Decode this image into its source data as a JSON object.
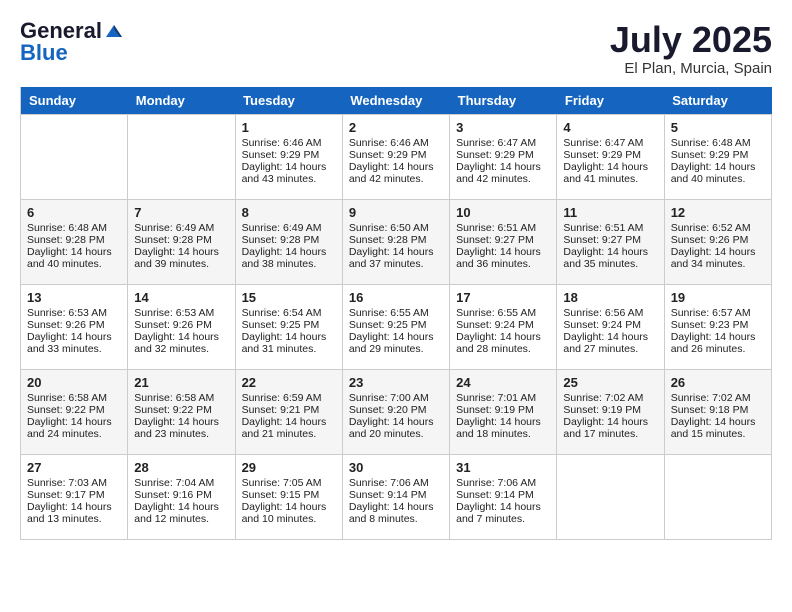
{
  "header": {
    "logo_general": "General",
    "logo_blue": "Blue",
    "month": "July 2025",
    "location": "El Plan, Murcia, Spain"
  },
  "days_of_week": [
    "Sunday",
    "Monday",
    "Tuesday",
    "Wednesday",
    "Thursday",
    "Friday",
    "Saturday"
  ],
  "weeks": [
    [
      {
        "day": "",
        "empty": true
      },
      {
        "day": "",
        "empty": true
      },
      {
        "day": "1",
        "sunrise": "Sunrise: 6:46 AM",
        "sunset": "Sunset: 9:29 PM",
        "daylight": "Daylight: 14 hours and 43 minutes."
      },
      {
        "day": "2",
        "sunrise": "Sunrise: 6:46 AM",
        "sunset": "Sunset: 9:29 PM",
        "daylight": "Daylight: 14 hours and 42 minutes."
      },
      {
        "day": "3",
        "sunrise": "Sunrise: 6:47 AM",
        "sunset": "Sunset: 9:29 PM",
        "daylight": "Daylight: 14 hours and 42 minutes."
      },
      {
        "day": "4",
        "sunrise": "Sunrise: 6:47 AM",
        "sunset": "Sunset: 9:29 PM",
        "daylight": "Daylight: 14 hours and 41 minutes."
      },
      {
        "day": "5",
        "sunrise": "Sunrise: 6:48 AM",
        "sunset": "Sunset: 9:29 PM",
        "daylight": "Daylight: 14 hours and 40 minutes."
      }
    ],
    [
      {
        "day": "6",
        "sunrise": "Sunrise: 6:48 AM",
        "sunset": "Sunset: 9:28 PM",
        "daylight": "Daylight: 14 hours and 40 minutes."
      },
      {
        "day": "7",
        "sunrise": "Sunrise: 6:49 AM",
        "sunset": "Sunset: 9:28 PM",
        "daylight": "Daylight: 14 hours and 39 minutes."
      },
      {
        "day": "8",
        "sunrise": "Sunrise: 6:49 AM",
        "sunset": "Sunset: 9:28 PM",
        "daylight": "Daylight: 14 hours and 38 minutes."
      },
      {
        "day": "9",
        "sunrise": "Sunrise: 6:50 AM",
        "sunset": "Sunset: 9:28 PM",
        "daylight": "Daylight: 14 hours and 37 minutes."
      },
      {
        "day": "10",
        "sunrise": "Sunrise: 6:51 AM",
        "sunset": "Sunset: 9:27 PM",
        "daylight": "Daylight: 14 hours and 36 minutes."
      },
      {
        "day": "11",
        "sunrise": "Sunrise: 6:51 AM",
        "sunset": "Sunset: 9:27 PM",
        "daylight": "Daylight: 14 hours and 35 minutes."
      },
      {
        "day": "12",
        "sunrise": "Sunrise: 6:52 AM",
        "sunset": "Sunset: 9:26 PM",
        "daylight": "Daylight: 14 hours and 34 minutes."
      }
    ],
    [
      {
        "day": "13",
        "sunrise": "Sunrise: 6:53 AM",
        "sunset": "Sunset: 9:26 PM",
        "daylight": "Daylight: 14 hours and 33 minutes."
      },
      {
        "day": "14",
        "sunrise": "Sunrise: 6:53 AM",
        "sunset": "Sunset: 9:26 PM",
        "daylight": "Daylight: 14 hours and 32 minutes."
      },
      {
        "day": "15",
        "sunrise": "Sunrise: 6:54 AM",
        "sunset": "Sunset: 9:25 PM",
        "daylight": "Daylight: 14 hours and 31 minutes."
      },
      {
        "day": "16",
        "sunrise": "Sunrise: 6:55 AM",
        "sunset": "Sunset: 9:25 PM",
        "daylight": "Daylight: 14 hours and 29 minutes."
      },
      {
        "day": "17",
        "sunrise": "Sunrise: 6:55 AM",
        "sunset": "Sunset: 9:24 PM",
        "daylight": "Daylight: 14 hours and 28 minutes."
      },
      {
        "day": "18",
        "sunrise": "Sunrise: 6:56 AM",
        "sunset": "Sunset: 9:24 PM",
        "daylight": "Daylight: 14 hours and 27 minutes."
      },
      {
        "day": "19",
        "sunrise": "Sunrise: 6:57 AM",
        "sunset": "Sunset: 9:23 PM",
        "daylight": "Daylight: 14 hours and 26 minutes."
      }
    ],
    [
      {
        "day": "20",
        "sunrise": "Sunrise: 6:58 AM",
        "sunset": "Sunset: 9:22 PM",
        "daylight": "Daylight: 14 hours and 24 minutes."
      },
      {
        "day": "21",
        "sunrise": "Sunrise: 6:58 AM",
        "sunset": "Sunset: 9:22 PM",
        "daylight": "Daylight: 14 hours and 23 minutes."
      },
      {
        "day": "22",
        "sunrise": "Sunrise: 6:59 AM",
        "sunset": "Sunset: 9:21 PM",
        "daylight": "Daylight: 14 hours and 21 minutes."
      },
      {
        "day": "23",
        "sunrise": "Sunrise: 7:00 AM",
        "sunset": "Sunset: 9:20 PM",
        "daylight": "Daylight: 14 hours and 20 minutes."
      },
      {
        "day": "24",
        "sunrise": "Sunrise: 7:01 AM",
        "sunset": "Sunset: 9:19 PM",
        "daylight": "Daylight: 14 hours and 18 minutes."
      },
      {
        "day": "25",
        "sunrise": "Sunrise: 7:02 AM",
        "sunset": "Sunset: 9:19 PM",
        "daylight": "Daylight: 14 hours and 17 minutes."
      },
      {
        "day": "26",
        "sunrise": "Sunrise: 7:02 AM",
        "sunset": "Sunset: 9:18 PM",
        "daylight": "Daylight: 14 hours and 15 minutes."
      }
    ],
    [
      {
        "day": "27",
        "sunrise": "Sunrise: 7:03 AM",
        "sunset": "Sunset: 9:17 PM",
        "daylight": "Daylight: 14 hours and 13 minutes."
      },
      {
        "day": "28",
        "sunrise": "Sunrise: 7:04 AM",
        "sunset": "Sunset: 9:16 PM",
        "daylight": "Daylight: 14 hours and 12 minutes."
      },
      {
        "day": "29",
        "sunrise": "Sunrise: 7:05 AM",
        "sunset": "Sunset: 9:15 PM",
        "daylight": "Daylight: 14 hours and 10 minutes."
      },
      {
        "day": "30",
        "sunrise": "Sunrise: 7:06 AM",
        "sunset": "Sunset: 9:14 PM",
        "daylight": "Daylight: 14 hours and 8 minutes."
      },
      {
        "day": "31",
        "sunrise": "Sunrise: 7:06 AM",
        "sunset": "Sunset: 9:14 PM",
        "daylight": "Daylight: 14 hours and 7 minutes."
      },
      {
        "day": "",
        "empty": true
      },
      {
        "day": "",
        "empty": true
      }
    ]
  ]
}
